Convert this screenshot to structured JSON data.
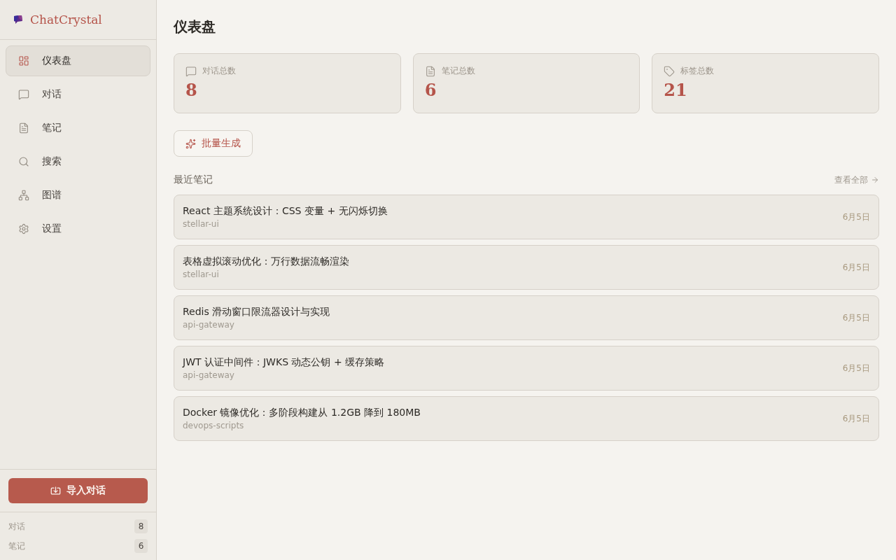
{
  "app": {
    "name": "ChatCrystal"
  },
  "sidebar": {
    "nav": [
      {
        "label": "仪表盘",
        "selected": true
      },
      {
        "label": "对话",
        "selected": false
      },
      {
        "label": "笔记",
        "selected": false
      },
      {
        "label": "搜索",
        "selected": false
      },
      {
        "label": "图谱",
        "selected": false
      },
      {
        "label": "设置",
        "selected": false
      }
    ],
    "import_button": "导入对话",
    "stats": [
      {
        "label": "对话",
        "count": "8"
      },
      {
        "label": "笔记",
        "count": "6"
      }
    ]
  },
  "page": {
    "title": "仪表盘"
  },
  "stat_cards": [
    {
      "label": "对话总数",
      "value": "8"
    },
    {
      "label": "笔记总数",
      "value": "6"
    },
    {
      "label": "标签总数",
      "value": "21"
    }
  ],
  "batch_button": "批量生成",
  "recent_notes": {
    "title": "最近笔记",
    "view_all": "查看全部",
    "notes": [
      {
        "title": "React 主题系统设计：CSS 变量 + 无闪烁切换",
        "project": "stellar-ui",
        "date": "6月5日"
      },
      {
        "title": "表格虚拟滚动优化：万行数据流畅渲染",
        "project": "stellar-ui",
        "date": "6月5日"
      },
      {
        "title": "Redis 滑动窗口限流器设计与实现",
        "project": "api-gateway",
        "date": "6月5日"
      },
      {
        "title": "JWT 认证中间件：JWKS 动态公钥 + 缓存策略",
        "project": "api-gateway",
        "date": "6月5日"
      },
      {
        "title": "Docker 镜像优化：多阶段构建从 1.2GB 降到 180MB",
        "project": "devops-scripts",
        "date": "6月5日"
      }
    ]
  }
}
